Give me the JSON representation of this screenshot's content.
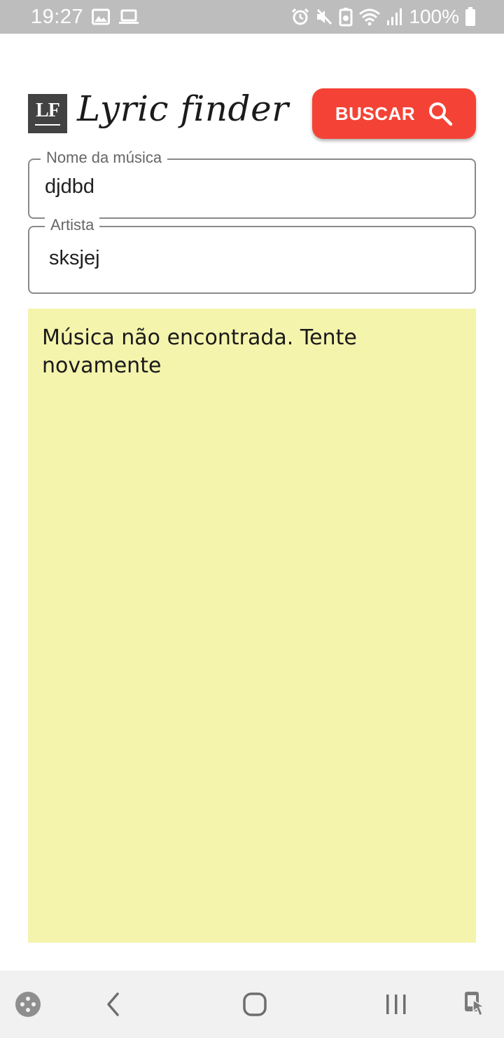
{
  "status_bar": {
    "time": "19:27",
    "battery": "100%"
  },
  "header": {
    "logo_text": "LF",
    "title": "Lyric finder",
    "search_button_label": "BUSCAR"
  },
  "form": {
    "song_label": "Nome da música",
    "song_value": "djdbd",
    "artist_label": "Artista",
    "artist_value": "sksjej"
  },
  "result": {
    "message": "Música não encontrada. Tente novamente"
  },
  "colors": {
    "accent": "#f44336",
    "result_background": "#f4f4ad",
    "status_bar": "#bdbdbd"
  },
  "icons": {
    "status_left": [
      "image-icon",
      "laptop-icon"
    ],
    "status_right": [
      "alarm-icon",
      "mute-icon",
      "battery-saver-icon",
      "wifi-icon",
      "signal-icon",
      "battery-icon"
    ],
    "search": "search-icon",
    "nav": [
      "game-launcher-icon",
      "back-icon",
      "home-icon",
      "recents-icon",
      "screen-touch-icon"
    ]
  }
}
